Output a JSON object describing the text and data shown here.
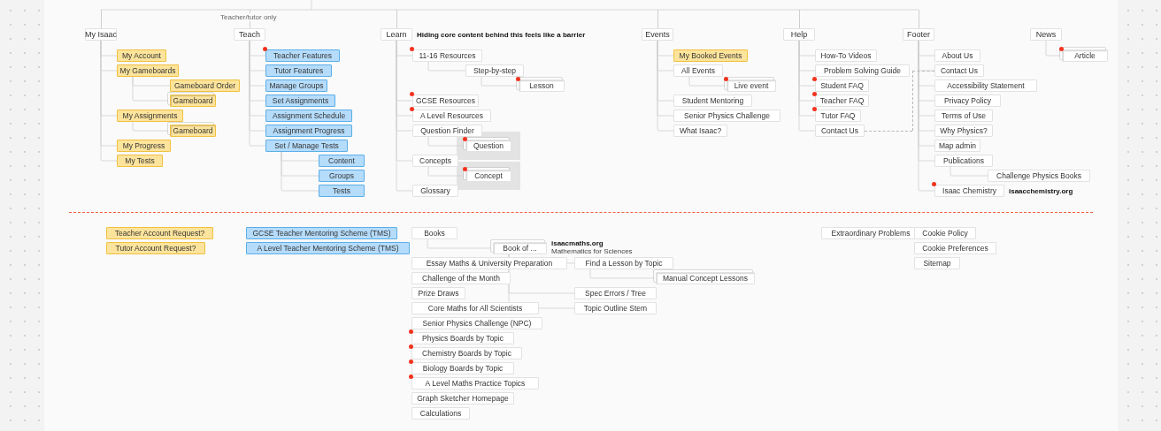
{
  "sections": [
    {
      "title": "My Isaac",
      "children": [
        {
          "text": "My Account",
          "kind": "student",
          "flagged": false,
          "stacked": false
        },
        {
          "text": "My Gameboards",
          "kind": "student",
          "flagged": false,
          "stacked": false,
          "children": [
            {
              "text": "Gameboard Order",
              "kind": "student",
              "flagged": false,
              "stacked": false
            },
            {
              "text": "Gameboard",
              "kind": "student",
              "flagged": false,
              "stacked": true
            }
          ]
        },
        {
          "text": "My Assignments",
          "kind": "student",
          "flagged": false,
          "stacked": false,
          "children": [
            {
              "text": "Gameboard",
              "kind": "student",
              "flagged": false,
              "stacked": true
            }
          ]
        },
        {
          "text": "My Progress",
          "kind": "student",
          "flagged": false,
          "stacked": false
        },
        {
          "text": "My Tests",
          "kind": "student",
          "flagged": false,
          "stacked": false
        }
      ]
    },
    {
      "title": "Teach",
      "label": "Teacher/tutor only",
      "children": [
        {
          "text": "Teacher Features",
          "kind": "teacher",
          "flagged": true,
          "stacked": false
        },
        {
          "text": "Tutor Features",
          "kind": "teacher",
          "flagged": false,
          "stacked": false
        },
        {
          "text": "Manage Groups",
          "kind": "teacher",
          "flagged": false,
          "stacked": false
        },
        {
          "text": "Set Assignments",
          "kind": "teacher",
          "flagged": false,
          "stacked": false
        },
        {
          "text": "Assignment Schedule",
          "kind": "teacher",
          "flagged": false,
          "stacked": false
        },
        {
          "text": "Assignment Progress",
          "kind": "teacher",
          "flagged": false,
          "stacked": false
        },
        {
          "text": "Set / Manage Tests",
          "kind": "teacher",
          "flagged": false,
          "stacked": false,
          "children": [
            {
              "text": "Content",
              "kind": "teacher",
              "flagged": false,
              "stacked": false
            },
            {
              "text": "Groups",
              "kind": "teacher",
              "flagged": false,
              "stacked": false
            },
            {
              "text": "Tests",
              "kind": "teacher",
              "flagged": false,
              "stacked": false
            }
          ]
        }
      ]
    },
    {
      "title": "Learn",
      "note": "Hiding core content behind this feels like a barrier",
      "children": [
        {
          "text": "11-16 Resources",
          "kind": "page",
          "flagged": true,
          "stacked": false,
          "children": [
            {
              "text": "Step-by-step",
              "kind": "page",
              "flagged": false,
              "stacked": false,
              "children": [
                {
                  "text": "Lesson",
                  "kind": "page",
                  "flagged": true,
                  "stacked": true
                }
              ]
            }
          ]
        },
        {
          "text": "GCSE Resources",
          "kind": "page",
          "flagged": true,
          "stacked": false
        },
        {
          "text": "A Level Resources",
          "kind": "page",
          "flagged": true,
          "stacked": false
        },
        {
          "text": "Question Finder",
          "kind": "page",
          "flagged": false,
          "stacked": false,
          "children": [
            {
              "text": "Question",
              "kind": "page",
              "flagged": true,
              "stacked": true,
              "boxed": true
            }
          ]
        },
        {
          "text": "Concepts",
          "kind": "page",
          "flagged": false,
          "stacked": false,
          "children": [
            {
              "text": "Concept",
              "kind": "page",
              "flagged": true,
              "stacked": true,
              "boxed": true
            }
          ]
        },
        {
          "text": "Glossary",
          "kind": "page",
          "flagged": false,
          "stacked": false
        }
      ]
    },
    {
      "title": "Events",
      "children": [
        {
          "text": "My Booked Events",
          "kind": "student",
          "flagged": false,
          "stacked": false
        },
        {
          "text": "All Events",
          "kind": "page",
          "flagged": false,
          "stacked": false,
          "children": [
            {
              "text": "Live event",
              "kind": "page",
              "flagged": true,
              "stacked": true
            }
          ]
        },
        {
          "text": "Student Mentoring",
          "kind": "page",
          "flagged": false,
          "stacked": false
        },
        {
          "text": "Senior Physics Challenge",
          "kind": "page",
          "flagged": false,
          "stacked": false
        },
        {
          "text": "What Isaac?",
          "kind": "page",
          "flagged": false,
          "stacked": false
        }
      ]
    },
    {
      "title": "Help",
      "children": [
        {
          "text": "How-To Videos",
          "kind": "page",
          "flagged": false,
          "stacked": false
        },
        {
          "text": "Problem Solving Guide",
          "kind": "page",
          "flagged": false,
          "stacked": false
        },
        {
          "text": "Student FAQ",
          "kind": "page",
          "flagged": true,
          "stacked": false
        },
        {
          "text": "Teacher FAQ",
          "kind": "page",
          "flagged": true,
          "stacked": false
        },
        {
          "text": "Tutor FAQ",
          "kind": "page",
          "flagged": true,
          "stacked": false
        },
        {
          "text": "Contact Us",
          "kind": "page",
          "flagged": false,
          "stacked": false,
          "linked": true
        }
      ]
    },
    {
      "title": "Footer",
      "children": [
        {
          "text": "About Us",
          "kind": "page",
          "flagged": false,
          "stacked": false
        },
        {
          "text": "Contact Us",
          "kind": "page",
          "flagged": false,
          "stacked": false,
          "linked": true
        },
        {
          "text": "Accessibility Statement",
          "kind": "page",
          "flagged": false,
          "stacked": false
        },
        {
          "text": "Privacy Policy",
          "kind": "page",
          "flagged": false,
          "stacked": false
        },
        {
          "text": "Terms of Use",
          "kind": "page",
          "flagged": false,
          "stacked": false
        },
        {
          "text": "Why Physics?",
          "kind": "page",
          "flagged": false,
          "stacked": false
        },
        {
          "text": "Map admin",
          "kind": "page",
          "flagged": false,
          "stacked": false
        },
        {
          "text": "Publications",
          "kind": "page",
          "flagged": false,
          "stacked": false,
          "children": [
            {
              "text": "Challenge Physics Books",
              "kind": "page",
              "flagged": false,
              "stacked": false
            }
          ]
        },
        {
          "text": "Isaac Chemistry",
          "kind": "page",
          "flagged": true,
          "stacked": false,
          "note": "isaacchemistry.org"
        }
      ]
    }
  ],
  "unconnected_sections": [
    {
      "title": "News",
      "children": [
        {
          "text": "Article",
          "kind": "page",
          "flagged": true,
          "stacked": true
        }
      ]
    }
  ],
  "bottom_groups": [
    {
      "items": [
        {
          "text": "Teacher Account Request?",
          "kind": "student",
          "flagged": false,
          "stacked": false
        },
        {
          "text": "Tutor Account Request?",
          "kind": "student",
          "flagged": false,
          "stacked": false
        }
      ]
    },
    {
      "items": [
        {
          "text": "GCSE Teacher Mentoring Scheme (TMS)",
          "kind": "teacher",
          "flagged": false,
          "stacked": false
        },
        {
          "text": "A Level Teacher Mentoring Scheme (TMS)",
          "kind": "teacher",
          "flagged": false,
          "stacked": false
        }
      ]
    },
    {
      "items": [
        {
          "text": "Books",
          "kind": "page",
          "flagged": false,
          "stacked": false,
          "children": [
            {
              "text": "Book of ...",
              "kind": "page",
              "flagged": false,
              "stacked": true,
              "note": "isaacmaths.org",
              "note_detail": "Mathematics for Sciences",
              "children": [
                {
                  "text": "Find a Lesson by Topic",
                  "kind": "page",
                  "flagged": false,
                  "stacked": false,
                  "children": [
                    {
                      "text": "Manual Concept Lessons",
                      "kind": "page",
                      "flagged": false,
                      "stacked": true
                    }
                  ]
                },
                {
                  "text": "Spec Errors / Tree",
                  "kind": "page",
                  "flagged": false,
                  "stacked": false
                },
                {
                  "text": "Topic Outline Stem",
                  "kind": "page",
                  "flagged": false,
                  "stacked": false
                }
              ]
            }
          ]
        }
      ]
    },
    {
      "items": [
        {
          "text": "Essay Maths & University Preparation",
          "kind": "page",
          "flagged": false,
          "stacked": false
        },
        {
          "text": "Challenge of the Month",
          "kind": "page",
          "flagged": false,
          "stacked": false
        },
        {
          "text": "Prize Draws",
          "kind": "page",
          "flagged": false,
          "stacked": false
        },
        {
          "text": "Core Maths for All Scientists",
          "kind": "page",
          "flagged": false,
          "stacked": false
        },
        {
          "text": "Senior Physics Challenge (NPC)",
          "kind": "page",
          "flagged": false,
          "stacked": false
        },
        {
          "text": "Physics Boards by Topic",
          "kind": "page",
          "flagged": true,
          "stacked": false
        },
        {
          "text": "Chemistry Boards by Topic",
          "kind": "page",
          "flagged": true,
          "stacked": false
        },
        {
          "text": "Biology Boards by Topic",
          "kind": "page",
          "flagged": true,
          "stacked": false
        },
        {
          "text": "A Level Maths Practice Topics",
          "kind": "page",
          "flagged": true,
          "stacked": false
        },
        {
          "text": "Graph Sketcher Homepage",
          "kind": "page",
          "flagged": false,
          "stacked": false
        },
        {
          "text": "Calculations",
          "kind": "page",
          "flagged": false,
          "stacked": false
        }
      ]
    },
    {
      "items": [
        {
          "text": "Extraordinary Problems",
          "kind": "page",
          "flagged": false,
          "stacked": false
        }
      ]
    },
    {
      "items": [
        {
          "text": "Cookie Policy",
          "kind": "page",
          "flagged": false,
          "stacked": false
        },
        {
          "text": "Cookie Preferences",
          "kind": "page",
          "flagged": false,
          "stacked": false
        },
        {
          "text": "Sitemap",
          "kind": "page",
          "flagged": false,
          "stacked": false
        }
      ]
    }
  ]
}
